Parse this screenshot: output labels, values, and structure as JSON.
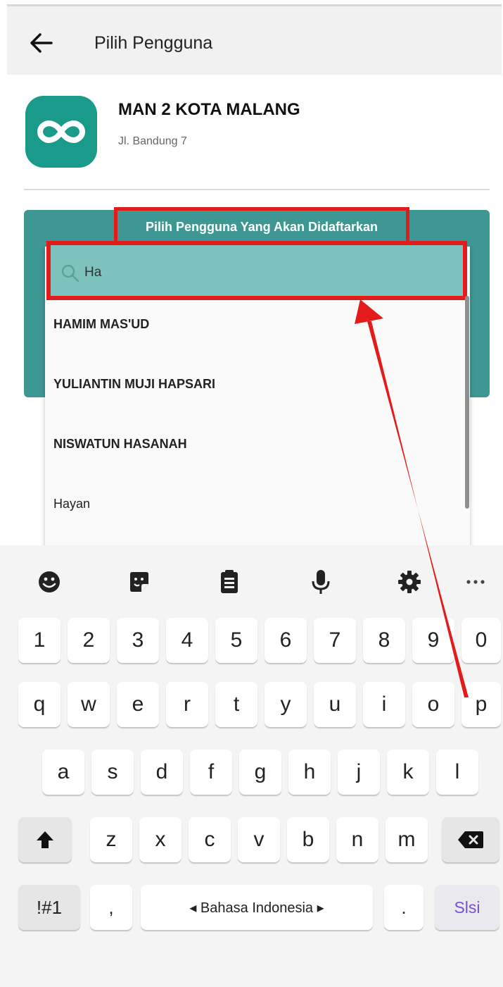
{
  "app_bar": {
    "title": "Pilih Pengguna"
  },
  "school": {
    "name": "MAN 2 KOTA MALANG",
    "address": "Jl. Bandung 7"
  },
  "panel": {
    "title": "Pilih Pengguna Yang Akan Didaftarkan"
  },
  "search": {
    "value": "Ha"
  },
  "users": [
    "HAMIM MAS'UD",
    "YULIANTIN MUJI HAPSARI",
    "NISWATUN HASANAH",
    "Hayan"
  ],
  "keyboard": {
    "numbers": [
      "1",
      "2",
      "3",
      "4",
      "5",
      "6",
      "7",
      "8",
      "9",
      "0"
    ],
    "row1": [
      "q",
      "w",
      "e",
      "r",
      "t",
      "y",
      "u",
      "i",
      "o",
      "p"
    ],
    "row2": [
      "a",
      "s",
      "d",
      "f",
      "g",
      "h",
      "j",
      "k",
      "l"
    ],
    "row3": [
      "z",
      "x",
      "c",
      "v",
      "b",
      "n",
      "m"
    ],
    "symbols_label": "!#1",
    "comma": ",",
    "space_label": "◂ Bahasa Indonesia ▸",
    "period": ".",
    "enter_label": "Slsi",
    "toolbar_icons": [
      "emoji-icon",
      "sticker-icon",
      "clipboard-icon",
      "microphone-icon",
      "settings-icon",
      "more-icon"
    ]
  },
  "colors": {
    "accent": "#3f9793",
    "logo": "#1a9a8a",
    "annotation": "#e31b1b",
    "search_bg": "#7ec2bd",
    "enter_text": "#7b4fd6"
  }
}
